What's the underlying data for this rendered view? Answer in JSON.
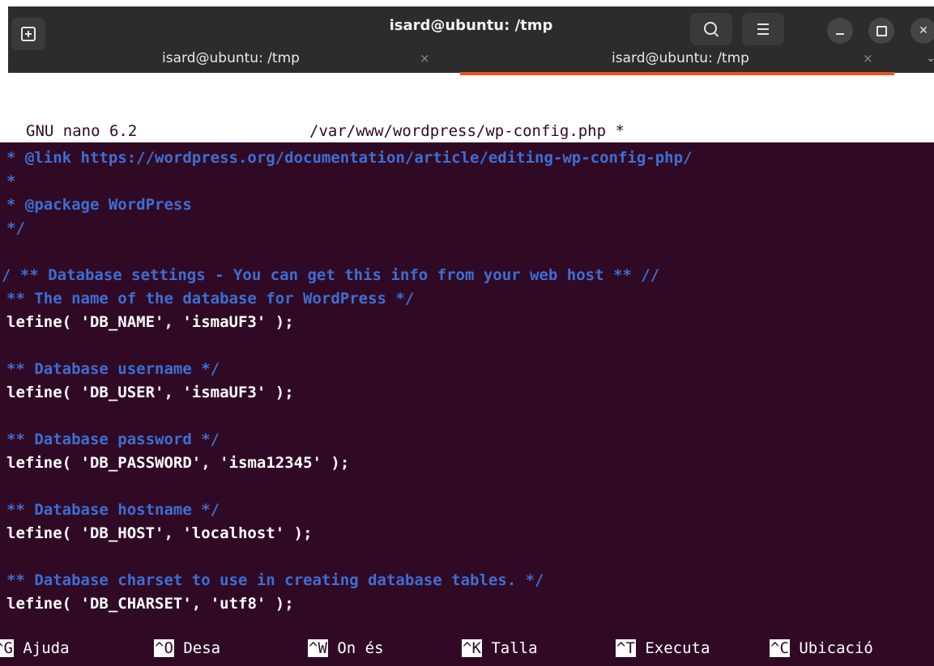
{
  "window": {
    "title": "isard@ubuntu: /tmp",
    "tabs": [
      {
        "label": "isard@ubuntu: /tmp",
        "active": false
      },
      {
        "label": "isard@ubuntu: /tmp",
        "active": true
      }
    ],
    "accent_color": "#e95420"
  },
  "icons": {
    "new_tab": "new-tab-icon",
    "search": "search-icon",
    "menu": "hamburger-menu-icon",
    "minimize": "minimize-icon",
    "maximize": "maximize-icon",
    "close": "close-icon",
    "tab_close": "×",
    "tabs_chevron": "chevron-down-icon",
    "close_glyph": "✕",
    "chevron_glyph": "⌄"
  },
  "nano": {
    "version": "GNU nano 6.2",
    "file": "/var/www/wordpress/wp-config.php *",
    "background_color": "#300a24",
    "comment_color": "#3d6ed4"
  },
  "editor": {
    "lines": [
      {
        "kind": "comment",
        "text": "* @link https://wordpress.org/documentation/article/editing-wp-config-php/"
      },
      {
        "kind": "comment",
        "text": "*"
      },
      {
        "kind": "comment",
        "text": "* @package WordPress"
      },
      {
        "kind": "comment",
        "text": "*/"
      },
      {
        "kind": "blank",
        "text": ""
      },
      {
        "kind": "comment",
        "text": "/ ** Database settings - You can get this info from your web host ** //"
      },
      {
        "kind": "comment",
        "text": "** The name of the database for WordPress */"
      },
      {
        "kind": "code",
        "prefix": "lefine( ",
        "key": "'DB_NAME'",
        "sep": ", ",
        "value": "'ismaUF3'",
        "suffix": " );"
      },
      {
        "kind": "blank",
        "text": ""
      },
      {
        "kind": "comment",
        "text": "** Database username */"
      },
      {
        "kind": "code",
        "prefix": "lefine( ",
        "key": "'DB_USER'",
        "sep": ", ",
        "value": "'ismaUF3'",
        "suffix": " );"
      },
      {
        "kind": "blank",
        "text": ""
      },
      {
        "kind": "comment",
        "text": "** Database password */"
      },
      {
        "kind": "code",
        "prefix": "lefine( ",
        "key": "'DB_PASSWORD'",
        "sep": ", ",
        "value": "'isma12345'",
        "suffix": " );"
      },
      {
        "kind": "blank",
        "text": ""
      },
      {
        "kind": "comment",
        "text": "** Database hostname */"
      },
      {
        "kind": "code",
        "prefix": "lefine( ",
        "key": "'DB_HOST'",
        "sep": ", ",
        "value": "'localhost'",
        "suffix": " );"
      },
      {
        "kind": "blank",
        "text": ""
      },
      {
        "kind": "comment",
        "text": "** Database charset to use in creating database tables. */"
      },
      {
        "kind": "code",
        "prefix": "lefine( ",
        "key": "'DB_CHARSET'",
        "sep": ", ",
        "value": "'utf8'",
        "suffix": " );"
      }
    ]
  },
  "shortcuts": [
    {
      "key": "^G",
      "label": "Ajuda"
    },
    {
      "key": "^O",
      "label": "Desa"
    },
    {
      "key": "^W",
      "label": "On és"
    },
    {
      "key": "^K",
      "label": "Talla"
    },
    {
      "key": "^T",
      "label": "Executa"
    },
    {
      "key": "^C",
      "label": "Ubicació"
    }
  ]
}
